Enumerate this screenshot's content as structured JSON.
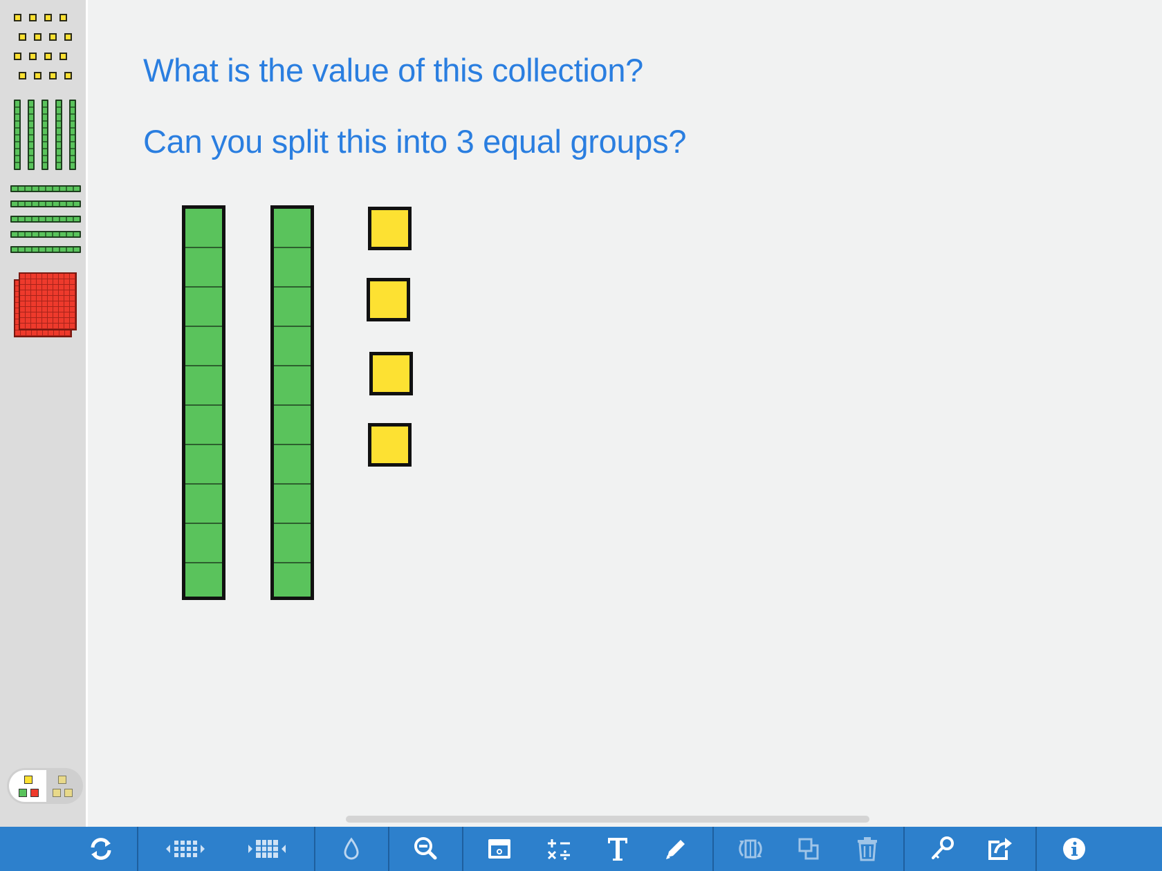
{
  "canvas": {
    "prompts": [
      "What is the value of this collection?",
      "Can you split this into 3 equal groups?"
    ],
    "blocks": {
      "tens_rods": 2,
      "units": 4
    }
  },
  "palette": {
    "items": [
      {
        "name": "units",
        "icon": "unit-cubes-icon",
        "color": "#fde132"
      },
      {
        "name": "vertical-rods",
        "icon": "vertical-tens-rods-icon",
        "color": "#5ac35c"
      },
      {
        "name": "horizontal-rods",
        "icon": "horizontal-tens-rods-icon",
        "color": "#5ac35c"
      },
      {
        "name": "flats",
        "icon": "hundreds-flats-icon",
        "color": "#ee3a2c"
      }
    ],
    "display_toggle": {
      "options": [
        "color-icon",
        "plain-icon"
      ],
      "selected": "color-icon"
    }
  },
  "toolbar": {
    "buttons": [
      {
        "name": "reset",
        "icon": "refresh-icon"
      },
      {
        "name": "shrink-grid",
        "icon": "grid-shrink-icon"
      },
      {
        "name": "expand-grid",
        "icon": "grid-expand-icon"
      },
      {
        "name": "fill-color",
        "icon": "drop-icon"
      },
      {
        "name": "zoom-out",
        "icon": "zoom-out-icon"
      },
      {
        "name": "cover",
        "icon": "cover-box-icon"
      },
      {
        "name": "math-operations",
        "icon": "operations-icon"
      },
      {
        "name": "text",
        "icon": "text-icon"
      },
      {
        "name": "draw",
        "icon": "pencil-icon"
      },
      {
        "name": "break-apart",
        "icon": "break-apart-icon",
        "enabled": false
      },
      {
        "name": "duplicate",
        "icon": "duplicate-icon",
        "enabled": false
      },
      {
        "name": "delete",
        "icon": "trash-icon",
        "enabled": false
      },
      {
        "name": "key",
        "icon": "key-icon"
      },
      {
        "name": "share",
        "icon": "share-icon"
      },
      {
        "name": "info",
        "icon": "info-icon"
      }
    ]
  },
  "colors": {
    "prompt_text": "#2a7ee0",
    "toolbar_bg": "#2d80cc",
    "tens": "#5ac35c",
    "units": "#fde132",
    "hundreds": "#ee3a2c"
  }
}
